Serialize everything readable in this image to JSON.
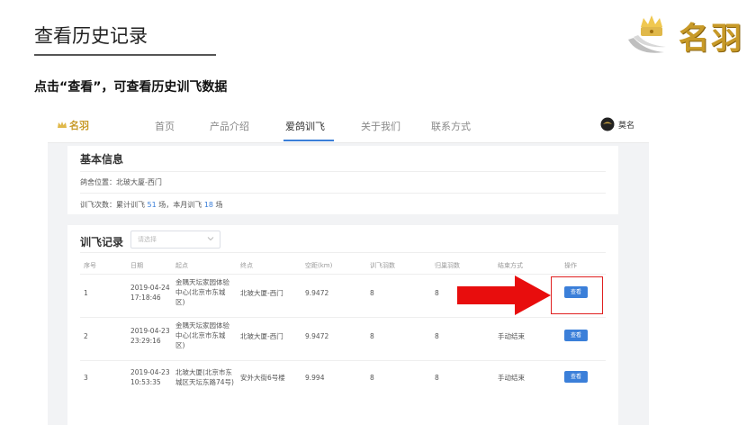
{
  "slide": {
    "title": "查看历史记录",
    "instruction": "点击“查看”，可查看历史训飞数据",
    "brand": "名羽"
  },
  "colors": {
    "accent": "#3b7fd9",
    "brand_gold": "#c89a28",
    "annotation_red": "#e02020"
  },
  "app": {
    "logo": "名羽",
    "nav": [
      {
        "label": "首页"
      },
      {
        "label": "产品介绍"
      },
      {
        "label": "爱鸽训飞",
        "active": true
      },
      {
        "label": "关于我们"
      },
      {
        "label": "联系方式"
      }
    ],
    "user": {
      "name": "莫名",
      "icon": "avatar-icon"
    },
    "basic_info": {
      "title": "基本信息",
      "loft_location": "鸽舍位置：北玻大厦-西门",
      "count_prefix": "训飞次数：累计训飞 ",
      "total": "51",
      "count_mid": " 场，本月训飞 ",
      "month": "18",
      "count_suffix": " 场"
    },
    "records": {
      "title": "训飞记录",
      "select_placeholder": "请选择",
      "columns": [
        "序号",
        "日期",
        "起点",
        "终点",
        "空距(km)",
        "训飞羽数",
        "归巢羽数",
        "结束方式",
        "操作"
      ],
      "rows": [
        {
          "no": "1",
          "date": "2019-04-24",
          "time": "17:18:46",
          "start": [
            "金隅天坛家园体验",
            "中心(北京市东城",
            "区)"
          ],
          "end": "北玻大厦-西门",
          "distance": "9.9472",
          "birds": "8",
          "returned": "8",
          "end_mode": "",
          "action": "查看"
        },
        {
          "no": "2",
          "date": "2019-04-23",
          "time": "23:29:16",
          "start": [
            "金隅天坛家园体验",
            "中心(北京市东城",
            "区)"
          ],
          "end": "北玻大厦-西门",
          "distance": "9.9472",
          "birds": "8",
          "returned": "8",
          "end_mode": "手动结束",
          "action": "查看"
        },
        {
          "no": "3",
          "date": "2019-04-23",
          "time": "10:53:35",
          "start": [
            "北玻大厦(北京市东",
            "城区天坛东路74号)",
            ""
          ],
          "end": "安外大街6号楼",
          "distance": "9.994",
          "birds": "8",
          "returned": "8",
          "end_mode": "手动结束",
          "action": "查看"
        }
      ]
    }
  }
}
